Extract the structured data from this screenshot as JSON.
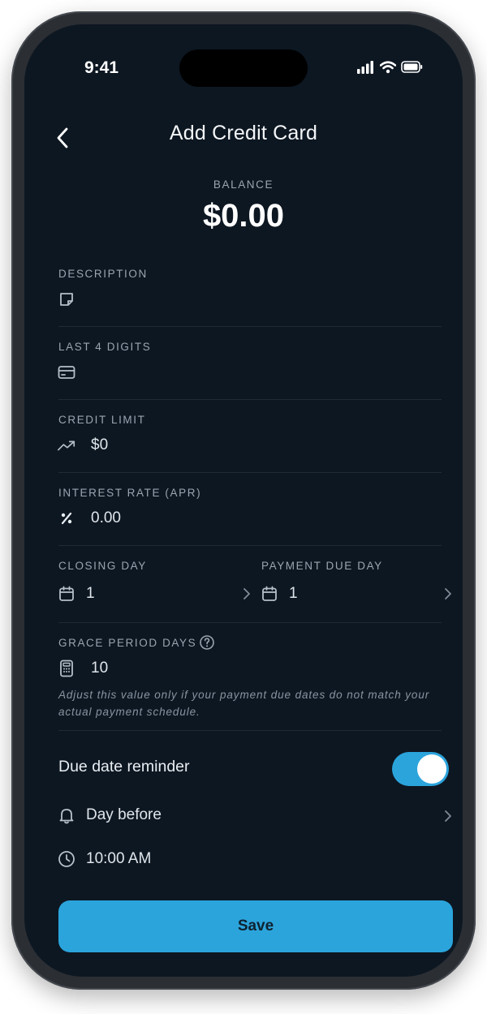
{
  "status_bar": {
    "time": "9:41"
  },
  "nav": {
    "title": "Add Credit Card"
  },
  "balance": {
    "label": "BALANCE",
    "value": "$0.00"
  },
  "fields": {
    "description": {
      "label": "DESCRIPTION",
      "value": ""
    },
    "last4": {
      "label": "LAST 4 DIGITS",
      "value": ""
    },
    "credit_limit": {
      "label": "CREDIT LIMIT",
      "value": "$0"
    },
    "interest_rate": {
      "label": "INTEREST RATE (APR)",
      "value": "0.00"
    },
    "closing_day": {
      "label": "CLOSING DAY",
      "value": "1"
    },
    "payment_due_day": {
      "label": "PAYMENT DUE DAY",
      "value": "1"
    },
    "grace_period": {
      "label": "GRACE PERIOD DAYS",
      "value": "10",
      "hint": "Adjust this value only if your payment due dates do not match your actual payment schedule."
    }
  },
  "reminder": {
    "label": "Due date reminder",
    "enabled": true,
    "timing": "Day before",
    "time": "10:00 AM"
  },
  "save_label": "Save",
  "colors": {
    "background": "#0d1722",
    "accent": "#2ba4dc",
    "label": "#9aa5b1",
    "divider": "#1f2a36"
  }
}
